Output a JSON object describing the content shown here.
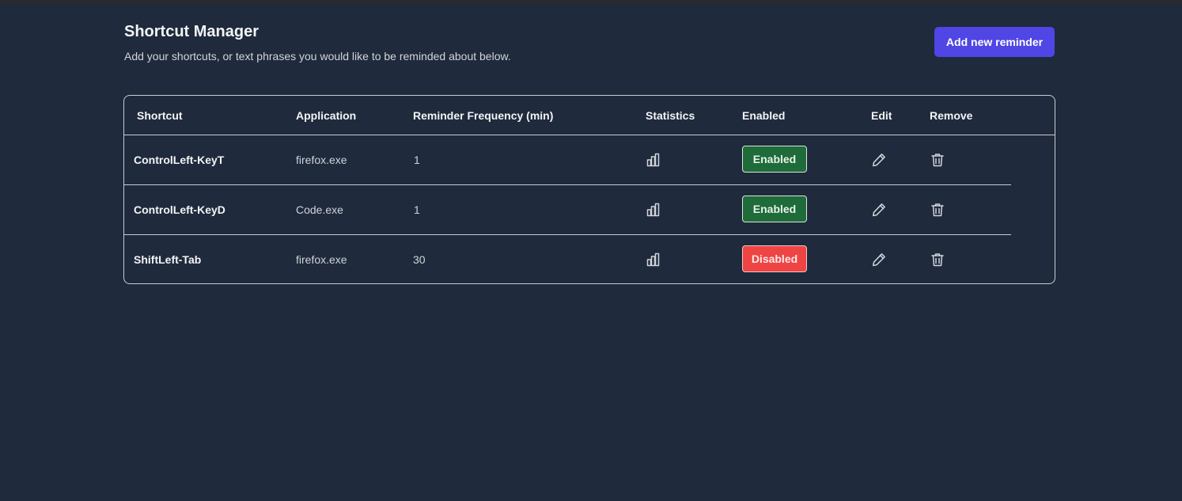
{
  "header": {
    "title": "Shortcut Manager",
    "subtitle": "Add your shortcuts, or text phrases you would like to be reminded about below.",
    "add_button": "Add new reminder"
  },
  "table": {
    "columns": [
      "Shortcut",
      "Application",
      "Reminder Frequency (min)",
      "Statistics",
      "Enabled",
      "Edit",
      "Remove"
    ],
    "rows": [
      {
        "shortcut": "ControlLeft-KeyT",
        "application": "firefox.exe",
        "frequency": "1",
        "status": "Enabled",
        "statistics_icon": "bar-chart-icon",
        "edit_icon": "pencil-icon",
        "remove_icon": "trash-icon"
      },
      {
        "shortcut": "ControlLeft-KeyD",
        "application": "Code.exe",
        "frequency": "1",
        "status": "Enabled",
        "statistics_icon": "bar-chart-icon",
        "edit_icon": "pencil-icon",
        "remove_icon": "trash-icon"
      },
      {
        "shortcut": "ShiftLeft-Tab",
        "application": "firefox.exe",
        "frequency": "30",
        "status": "Disabled",
        "statistics_icon": "bar-chart-icon",
        "edit_icon": "pencil-icon",
        "remove_icon": "trash-icon"
      }
    ]
  },
  "colors": {
    "background": "#1f2a3c",
    "accent": "#4f46e5",
    "enabled": "#1f6b3a",
    "disabled": "#ef4444"
  }
}
